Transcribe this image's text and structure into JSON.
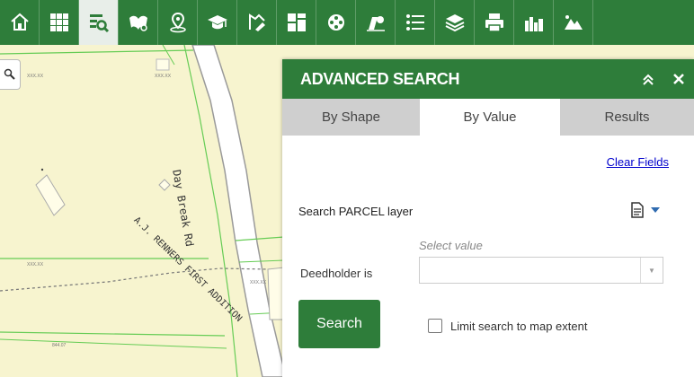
{
  "toolbar": {
    "tools": [
      {
        "icon": "home-icon"
      },
      {
        "icon": "grid-icon"
      },
      {
        "icon": "advanced-search-icon",
        "active": true
      },
      {
        "icon": "map-locator-icon"
      },
      {
        "icon": "location-pin-icon"
      },
      {
        "icon": "graduation-cap-icon"
      },
      {
        "icon": "drawing-tool-icon"
      },
      {
        "icon": "dashboard-icon"
      },
      {
        "icon": "film-reel-icon"
      },
      {
        "icon": "measure-icon"
      },
      {
        "icon": "list-icon"
      },
      {
        "icon": "layers-icon"
      },
      {
        "icon": "print-icon"
      },
      {
        "icon": "city-icon"
      },
      {
        "icon": "terrain-icon"
      }
    ]
  },
  "map": {
    "road_label": "Day Break Rd",
    "subdivision_label": "A.J. RENNERS FIRST ADDITION",
    "parcel_labels": [
      "XXX.XX",
      "XXX.XX",
      "XXX.XX",
      "XXX.XX",
      "844.07"
    ]
  },
  "panel": {
    "title": "ADVANCED SEARCH",
    "collapse_icon": "double-chevron-up-icon",
    "close_icon": "close-icon",
    "tabs": [
      {
        "label": "By Shape",
        "active": false
      },
      {
        "label": "By Value",
        "active": true
      },
      {
        "label": "Results",
        "active": false
      }
    ],
    "clear_fields": "Clear Fields",
    "layer_label": "Search PARCEL layer",
    "hint": "Select value",
    "field_label": "Deedholder is",
    "selected_value": "",
    "search_button": "Search",
    "limit_label": "Limit search to map extent",
    "limit_checked": false
  },
  "colors": {
    "toolbar_green": "#2e7d3a",
    "map_background": "#f7f4cf",
    "parcel_lines": "#66cc55",
    "link_blue": "#0000cc"
  }
}
